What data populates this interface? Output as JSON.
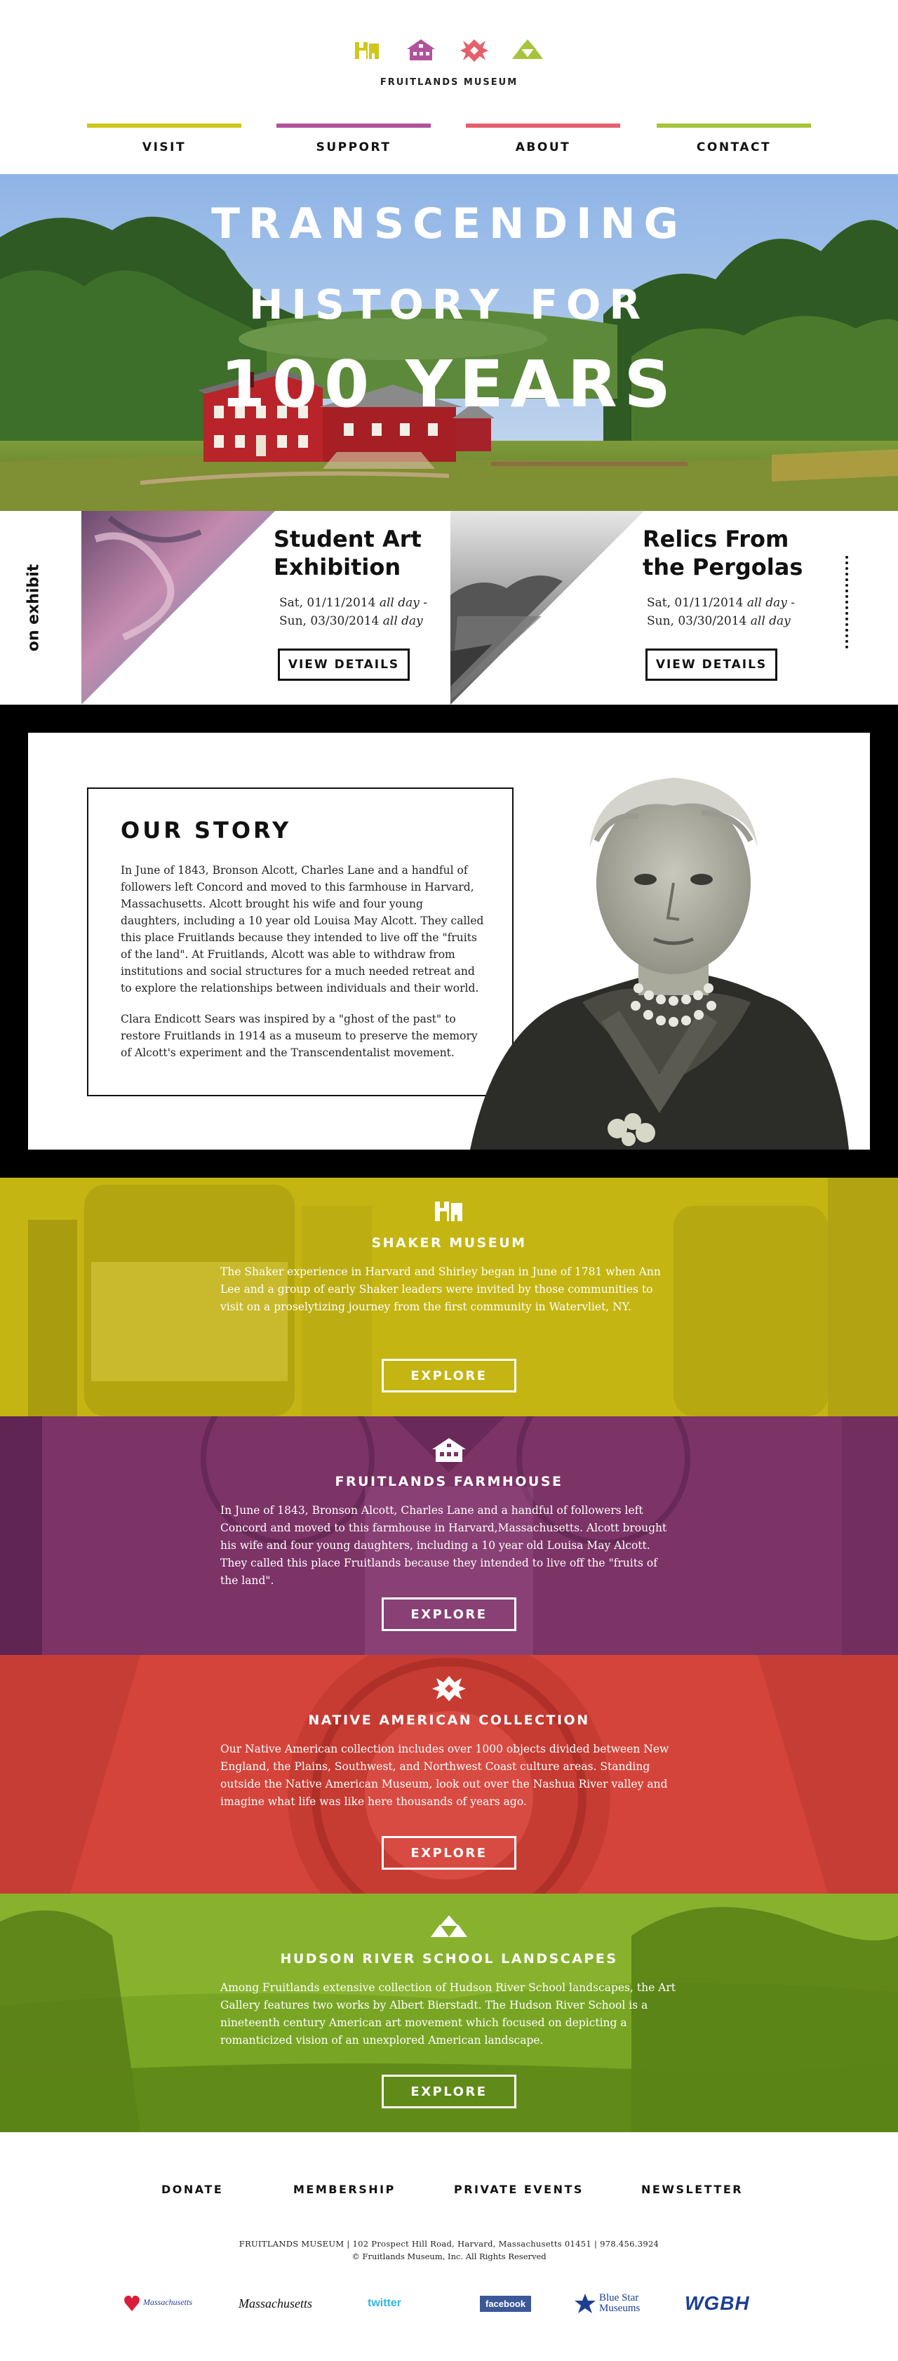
{
  "brand": {
    "name": "FRUITLANDS MUSEUM",
    "colors": {
      "yellow": "#cfc719",
      "purple": "#b0539b",
      "red": "#e5606b",
      "green": "#a6c43a"
    },
    "logo_icons": [
      "shaker-icon",
      "farmhouse-icon",
      "native-american-icon",
      "hudson-river-icon"
    ]
  },
  "nav": [
    {
      "label": "VISIT",
      "color": "#cfc719"
    },
    {
      "label": "SUPPORT",
      "color": "#b0539b"
    },
    {
      "label": "ABOUT",
      "color": "#e5606b"
    },
    {
      "label": "CONTACT",
      "color": "#a6c43a"
    }
  ],
  "hero": {
    "line1": "TRANSCENDING",
    "line2": "HISTORY FOR",
    "line3": "100 YEARS"
  },
  "exhibits": {
    "label": "on exhibit",
    "items": [
      {
        "title_line1": "Student Art",
        "title_line2": "Exhibition",
        "date_line1_prefix": "Sat, 01/11/2014",
        "date_line1_suffix": "all day",
        "date_line1_end": " -",
        "date_line2_prefix": "Sun, 03/30/2014",
        "date_line2_suffix": "all day",
        "button": "VIEW DETAILS"
      },
      {
        "title_line1": "Relics From",
        "title_line2": "the Pergolas",
        "date_line1_prefix": "Sat, 01/11/2014",
        "date_line1_suffix": "all day",
        "date_line1_end": " -",
        "date_line2_prefix": "Sun, 03/30/2014",
        "date_line2_suffix": "all day",
        "button": "VIEW DETAILS"
      }
    ]
  },
  "story": {
    "title": "OUR STORY",
    "p1": "In June of 1843, Bronson Alcott, Charles Lane and a handful of followers left Concord and moved to this farmhouse in Harvard, Massachusetts.  Alcott brought his wife and four young daughters, including a 10 year old Louisa May Alcott. They called this place Fruitlands because they intended to live off the \"fruits of the land\". At Fruitlands, Alcott was able to withdraw from institutions and social structures for a much needed retreat and to explore the relationships between individuals and their world.",
    "p2": "Clara Endicott Sears was inspired by a \"ghost of the past\" to restore Fruitlands in 1914 as a museum to preserve the memory of Alcott's experiment and the Transcendentalist movement."
  },
  "collections": [
    {
      "title": "SHAKER MUSEUM",
      "icon": "shaker-icon",
      "color": "#c4b512",
      "text": "The Shaker experience in Harvard and Shirley began in June of 1781 when Ann Lee and a group of early Shaker leaders were invited by those communities to visit on a proselytizing journey from the first community in Watervliet, NY.",
      "button": "EXPLORE"
    },
    {
      "title": "FRUITLANDS FARMHOUSE",
      "icon": "farmhouse-icon",
      "color": "#8a3a6e",
      "text": "In June of 1843, Bronson Alcott, Charles Lane and a handful of followers left Concord and moved to this farmhouse in Harvard,Massachusetts.  Alcott brought his wife and four young daughters, including a 10 year old Louisa May Alcott.  They called this place Fruitlands because they intended to live off the \"fruits of the land\".",
      "button": "EXPLORE"
    },
    {
      "title": "NATIVE AMERICAN COLLECTION",
      "icon": "native-american-icon",
      "color": "#d8453c",
      "text": "Our Native American collection includes over 1000 objects divided between New England, the Plains, Southwest, and Northwest Coast culture areas. Standing outside the Native American Museum, look out over the Nashua River valley and imagine what life was like here thousands of years ago.",
      "button": "EXPLORE"
    },
    {
      "title": "HUDSON RIVER SCHOOL LANDSCAPES",
      "icon": "hudson-river-icon",
      "color": "#7aa01c",
      "text": "Among Fruitlands extensive collection of Hudson River School landscapes, the Art Gallery features two works by Albert Bierstadt. The Hudson River School is a nineteenth century American art movement which focused on depicting a romanticized vision of an unexplored American landscape.",
      "button": "EXPLORE"
    }
  ],
  "footer": {
    "links": [
      "DONATE",
      "MEMBERSHIP",
      "PRIVATE EVENTS",
      "NEWSLETTER"
    ],
    "address": "FRUITLANDS MUSEUM  |  102 Prospect Hill Road, Harvard, Massachusetts 01451  |  978.456.3924",
    "copyright": "© Fruitlands Museum, Inc. All Rights Reserved",
    "sponsors": [
      "Massachusetts",
      "Massachusetts",
      "twitter",
      "facebook",
      "Blue Star Museums",
      "WGBH"
    ]
  }
}
